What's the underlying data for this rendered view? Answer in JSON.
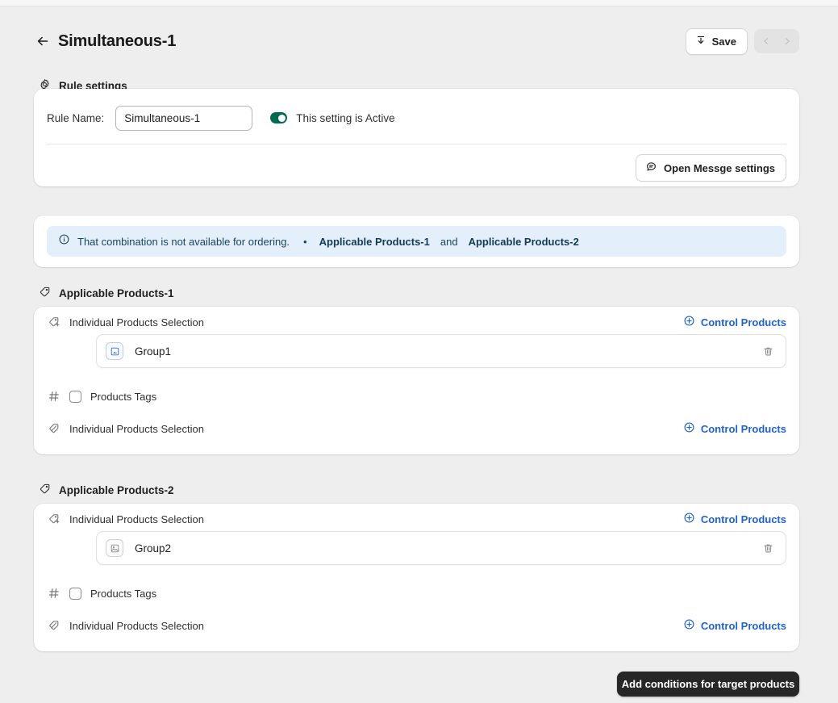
{
  "header": {
    "back_icon": "arrow-left-icon",
    "title": "Simultaneous-1",
    "save_label": "Save",
    "save_icon": "download-icon",
    "prev_icon": "chevron-left-icon",
    "next_icon": "chevron-right-icon"
  },
  "rule_settings": {
    "section_icon": "gear-icon",
    "section_title": "Rule settings",
    "rule_name_label": "Rule Name:",
    "rule_name_value": "Simultaneous-1",
    "rule_name_placeholder": "Rule Name",
    "toggle_state": "on",
    "toggle_label": "This setting is Active",
    "message_button_label": "Open Messge settings",
    "message_button_icon": "chat-bubble-icon"
  },
  "banner": {
    "icon": "info-circle-icon",
    "text": "That combination is not available for ordering.",
    "separator": "•",
    "item_one": "Applicable Products-1",
    "conjunction": "and",
    "item_two": "Applicable Products-2",
    "background_color": "#e3f0fb",
    "text_color": "#19445e"
  },
  "sections": [
    {
      "icon": "tag-icon",
      "title": "Applicable Products-1",
      "rows": [
        {
          "icon": "tag-plus-icon",
          "label": "Individual Products Selection",
          "action_label": "Control Products",
          "action_icon": "plus-circle-icon"
        },
        {
          "icon": "hash-icon",
          "label": "Products Tags",
          "checkbox": "unchecked"
        },
        {
          "icon": "tag-slash-icon",
          "label": "Individual Products Selection",
          "action_label": "Control Products",
          "action_icon": "plus-circle-icon"
        }
      ],
      "item": {
        "thumb_icon": "image-blue-icon",
        "name": "Group1",
        "delete_icon": "trash-icon"
      }
    },
    {
      "icon": "tag-icon",
      "title": "Applicable Products-2",
      "rows": [
        {
          "icon": "tag-plus-icon",
          "label": "Individual Products Selection",
          "action_label": "Control Products",
          "action_icon": "plus-circle-icon"
        },
        {
          "icon": "hash-icon",
          "label": "Products Tags",
          "checkbox": "unchecked"
        },
        {
          "icon": "tag-slash-icon",
          "label": "Individual Products Selection",
          "action_label": "Control Products",
          "action_icon": "plus-circle-icon"
        }
      ],
      "item": {
        "thumb_icon": "image-placeholder-icon",
        "name": "Group2",
        "delete_icon": "trash-icon"
      }
    }
  ],
  "footer": {
    "add_conditions_label": "Add conditions for target products"
  },
  "colors": {
    "page_background": "#eeeeee",
    "card_background": "#ffffff",
    "accent_link": "#1f62d6",
    "toggle_active": "#036a52",
    "primary_button": "#272727"
  }
}
